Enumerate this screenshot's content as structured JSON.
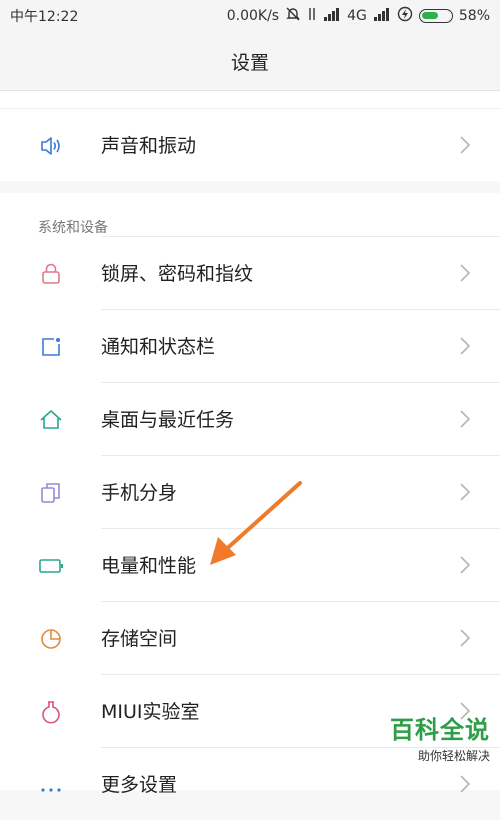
{
  "status_bar": {
    "time": "中午12:22",
    "network_speed": "0.00K/s",
    "network_type": "4G",
    "battery_percent": "58%",
    "battery_level": 0.58
  },
  "header": {
    "title": "设置"
  },
  "top_item": {
    "label": "声音和振动",
    "icon": "speaker-icon"
  },
  "section": {
    "title": "系统和设备"
  },
  "items": [
    {
      "label": "锁屏、密码和指纹",
      "icon": "lock-icon",
      "color": "#e07a8a"
    },
    {
      "label": "通知和状态栏",
      "icon": "notification-icon",
      "color": "#3a7bd5"
    },
    {
      "label": "桌面与最近任务",
      "icon": "home-icon",
      "color": "#27a88a"
    },
    {
      "label": "手机分身",
      "icon": "dual-apps-icon",
      "color": "#9a88d6"
    },
    {
      "label": "电量和性能",
      "icon": "battery-icon",
      "color": "#27a88a"
    },
    {
      "label": "存储空间",
      "icon": "storage-icon",
      "color": "#e58a3b"
    },
    {
      "label": "MIUI实验室",
      "icon": "flask-icon",
      "color": "#d9557a"
    },
    {
      "label": "更多设置",
      "icon": "more-icon",
      "color": "#3a7bd5"
    }
  ],
  "watermark": {
    "title": "百科全说",
    "subtitle": "助你轻松解决"
  },
  "colors": {
    "annotation_arrow": "#f07a2a",
    "watermark_green": "#2e9d47"
  }
}
